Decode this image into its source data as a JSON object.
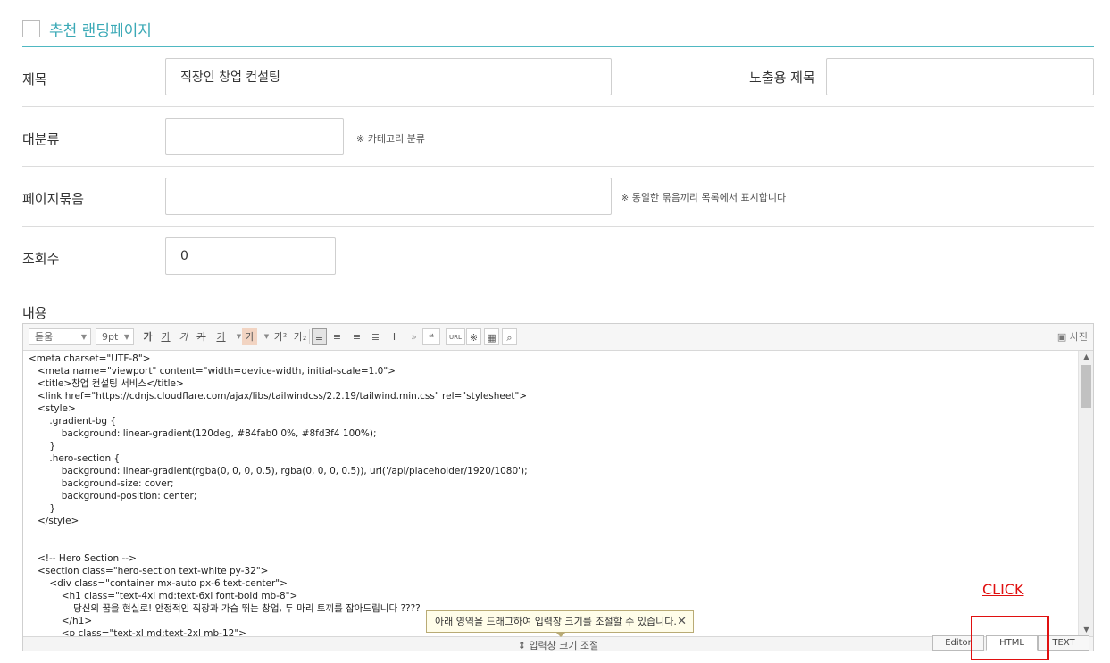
{
  "header": {
    "title": "추천 랜딩페이지"
  },
  "fields": {
    "title": {
      "label": "제목",
      "value": "직장인 창업 컨설팅"
    },
    "display_title": {
      "label": "노출용 제목",
      "value": ""
    },
    "category": {
      "label": "대분류",
      "value": "",
      "note": "※ 카테고리 분류"
    },
    "page_group": {
      "label": "페이지묶음",
      "value": "",
      "note": "※ 동일한 묶음끼리 목록에서 표시합니다"
    },
    "views": {
      "label": "조회수",
      "value": "0"
    },
    "content": {
      "label": "내용"
    }
  },
  "toolbar": {
    "font": "돋움",
    "size": "9pt",
    "bold": "가",
    "underline": "가",
    "italic": "가",
    "strike": "가",
    "font_color": "가",
    "bg_color": "가",
    "superscript": "가²",
    "subscript": "가₂",
    "quote": "❝",
    "url": "URL",
    "photo": "사진"
  },
  "code_lines": [
    "<meta charset=\"UTF-8\">",
    "   <meta name=\"viewport\" content=\"width=device-width, initial-scale=1.0\">",
    "   <title>창업 컨설팅 서비스</title>",
    "   <link href=\"https://cdnjs.cloudflare.com/ajax/libs/tailwindcss/2.2.19/tailwind.min.css\" rel=\"stylesheet\">",
    "   <style>",
    "       .gradient-bg {",
    "           background: linear-gradient(120deg, #84fab0 0%, #8fd3f4 100%);",
    "       }",
    "       .hero-section {",
    "           background: linear-gradient(rgba(0, 0, 0, 0.5), rgba(0, 0, 0, 0.5)), url('/api/placeholder/1920/1080');",
    "           background-size: cover;",
    "           background-position: center;",
    "       }",
    "   </style>",
    "",
    "",
    "   <!-- Hero Section -->",
    "   <section class=\"hero-section text-white py-32\">",
    "       <div class=\"container mx-auto px-6 text-center\">",
    "           <h1 class=\"text-4xl md:text-6xl font-bold mb-8\">",
    "               당신의 꿈을 현실로! 안정적인 직장과 가슴 뛰는 창업, 두 마리 토끼를 잡아드립니다 ????",
    "           </h1>",
    "           <p class=\"text-xl md:text-2xl mb-12\">"
  ],
  "statusbar": {
    "resize": "⇕ 입력창 크기 조절",
    "tabs": [
      "Editor",
      "HTML",
      "TEXT"
    ]
  },
  "tooltip": "아래 영역을 드래그하여 입력창 크기를 조절할 수 있습니다.",
  "annotation": {
    "click": "CLICK"
  }
}
